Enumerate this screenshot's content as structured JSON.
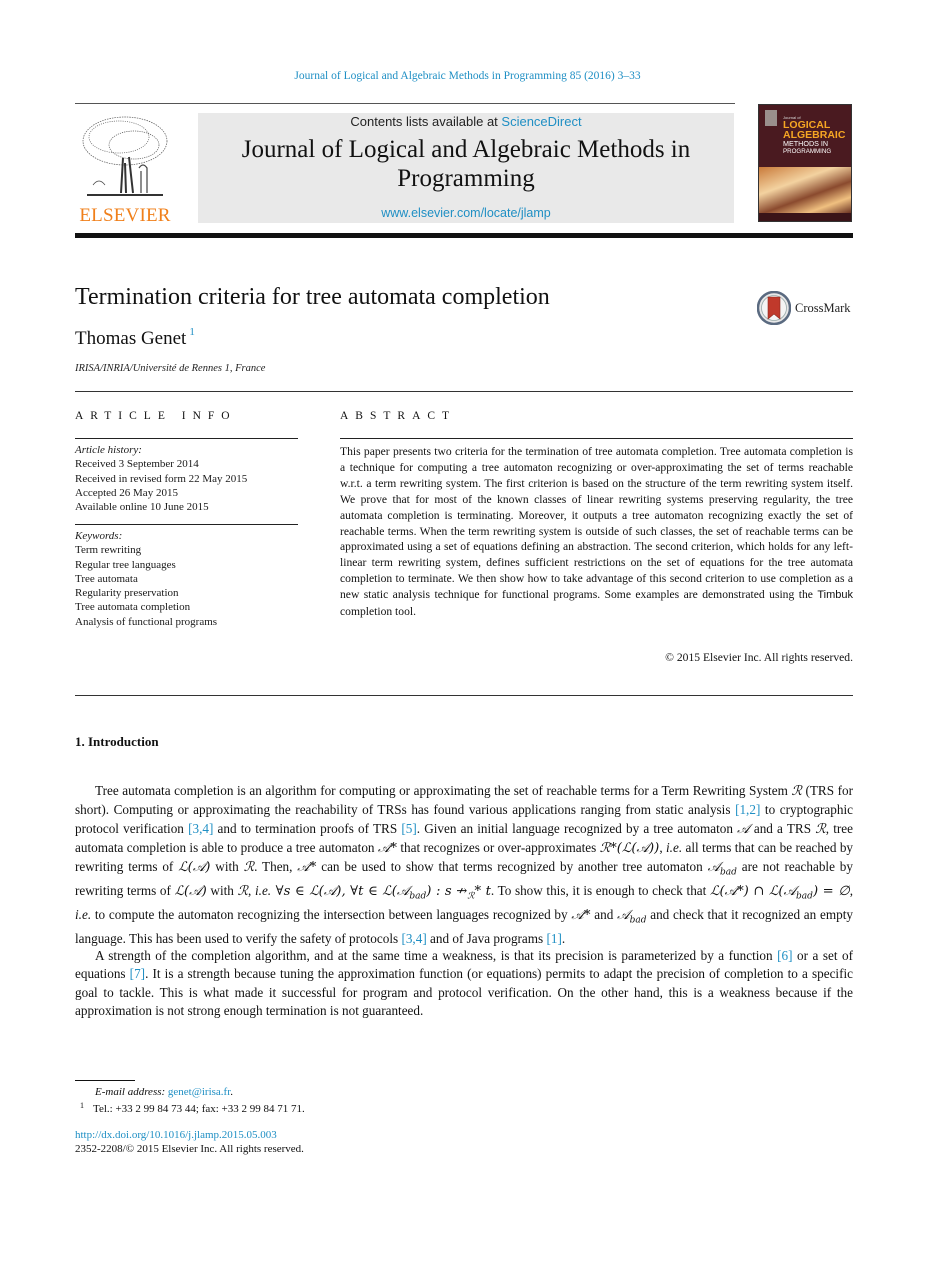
{
  "citation": "Journal of Logical and Algebraic Methods in Programming 85 (2016) 3–33",
  "header": {
    "publisher_logo_text": "ELSEVIER",
    "contents_prefix": "Contents lists available at ",
    "contents_link": "ScienceDirect",
    "journal_title": "Journal of Logical and Algebraic Methods in Programming",
    "journal_url": "www.elsevier.com/locate/jlamp",
    "cover": {
      "small_text": "Journal of",
      "line1": "LOGICAL",
      "line2": "ALGEBRAIC",
      "line3": "METHODS IN",
      "line4": "PROGRAMMING"
    },
    "colors": {
      "link": "#1f8fc4",
      "elsevier_orange": "#f07f1a",
      "cover_bg": "#4a1a20",
      "cover_title": "#f6a623"
    }
  },
  "paper": {
    "title": "Termination criteria for tree automata completion",
    "crossmark_label": "CrossMark",
    "author": "Thomas Genet",
    "author_footnote": "1",
    "affiliation": "IRISA/INRIA/Université de Rennes 1, France"
  },
  "article_info": {
    "heading": "ARTICLE INFO",
    "history_label": "Article history:",
    "history": [
      "Received 3 September 2014",
      "Received in revised form 22 May 2015",
      "Accepted 26 May 2015",
      "Available online 10 June 2015"
    ],
    "keywords_label": "Keywords:",
    "keywords": [
      "Term rewriting",
      "Regular tree languages",
      "Tree automata",
      "Regularity preservation",
      "Tree automata completion",
      "Analysis of functional programs"
    ]
  },
  "abstract": {
    "heading": "ABSTRACT",
    "text_before_tool": "This paper presents two criteria for the termination of tree automata completion. Tree automata completion is a technique for computing a tree automaton recognizing or over-approximating the set of terms reachable w.r.t. a term rewriting system. The first criterion is based on the structure of the term rewriting system itself. We prove that for most of the known classes of linear rewriting systems preserving regularity, the tree automata completion is terminating. Moreover, it outputs a tree automaton recognizing exactly the set of reachable terms. When the term rewriting system is outside of such classes, the set of reachable terms can be approximated using a set of equations defining an abstraction. The second criterion, which holds for any left-linear term rewriting system, defines sufficient restrictions on the set of equations for the tree automata completion to terminate. We then show how to take advantage of this second criterion to use completion as a new static analysis technique for functional programs. Some examples are demonstrated using the ",
    "tool_name": "Timbuk",
    "text_after_tool": " completion tool.",
    "copyright": "© 2015 Elsevier Inc. All rights reserved."
  },
  "introduction": {
    "heading": "1. Introduction",
    "p1": {
      "s1": "Tree automata completion is an algorithm for computing or approximating the set of reachable terms for a Term Rewriting System ",
      "s2": " (TRS for short). Computing or approximating the reachability of TRSs has found various applications ranging from static analysis ",
      "ref_a": "[1,2]",
      "s3": " to cryptographic protocol verification ",
      "ref_b": "[3,4]",
      "s4": " and to termination proofs of TRS ",
      "ref_c": "[5]",
      "s5": ". Given an initial language recognized by a tree automaton ",
      "s6": " and a TRS ",
      "s7": ", tree automata completion is able to produce a tree automaton ",
      "s8": " that recognizes or over-approximates ",
      "s9": ", ",
      "ie": "i.e.",
      "s10": " all terms that can be reached by rewriting terms of ",
      "s11": " with ",
      "s12": ". Then, ",
      "s13": " can be used to show that terms recognized by another tree automaton ",
      "s14": " are not reachable by rewriting terms of ",
      "s15": " with ",
      "s16": ", ",
      "s17": " ∀",
      "s18": ". To show this, it is enough to check that ",
      "s19": ", ",
      "s20": " to compute the automaton recognizing the intersection between languages recognized by ",
      "s21": " and ",
      "s22": " and check that it recognized an empty language. This has been used to verify the safety of protocols ",
      "ref_d": "[3,4]",
      "s23": " and of Java programs ",
      "ref_e": "[1]",
      "s24": "."
    },
    "p2": {
      "s1": "A strength of the completion algorithm, and at the same time a weakness, is that its precision is parameterized by a function ",
      "ref_a": "[6]",
      "s2": " or a set of equations ",
      "ref_b": "[7]",
      "s3": ". It is a strength because tuning the approximation function (or equations) permits to adapt the precision of completion to a specific goal to tackle. This is what made it successful for program and protocol verification. On the other hand, this is a weakness because if the approximation is not strong enough termination is not guaranteed."
    }
  },
  "footnotes": {
    "email_label": "E-mail address: ",
    "email": "genet@irisa.fr",
    "email_end": ".",
    "fn1_mark": "1",
    "fn1_text": "Tel.: +33 2 99 84 73 44; fax: +33 2 99 84 71 71.",
    "doi": "http://dx.doi.org/10.1016/j.jlamp.2015.05.003",
    "issn": "2352-2208/© 2015 Elsevier Inc. All rights reserved."
  }
}
